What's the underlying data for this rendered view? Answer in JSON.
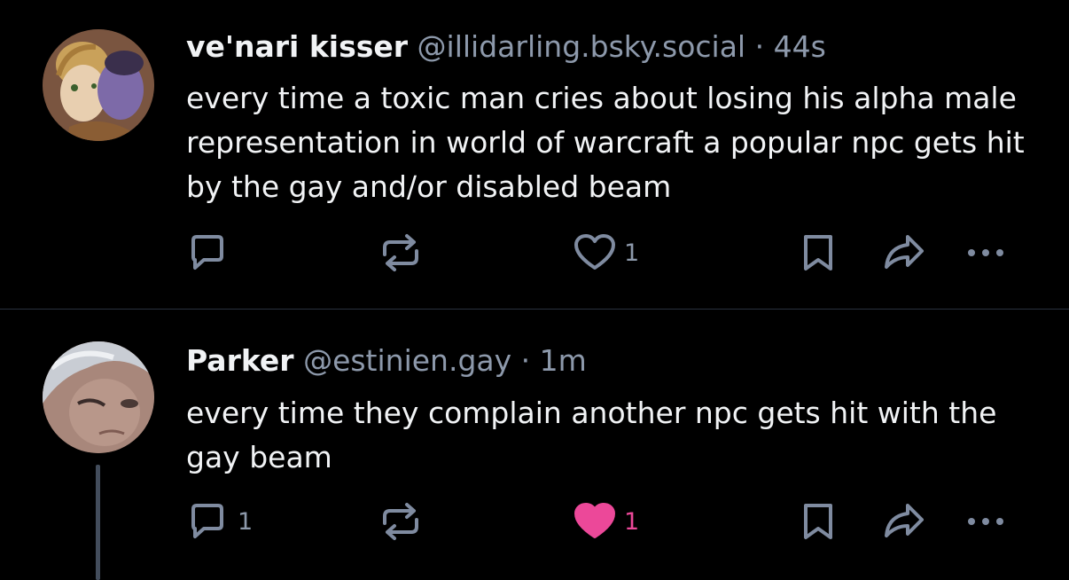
{
  "posts": [
    {
      "author": {
        "display_name": "ve'nari kisser",
        "handle": "@illidarling.bsky.social",
        "avatar_icon": "illustrated-avatar"
      },
      "separator": "·",
      "time": "44s",
      "text": "every time a toxic man cries about losing his alpha male representation in world of warcraft a popular npc gets hit by the gay and/or disabled beam",
      "actions": {
        "reply_count": "",
        "repost_count": "",
        "like_count": "1",
        "liked": false
      }
    },
    {
      "author": {
        "display_name": "Parker",
        "handle": "@estinien.gay",
        "avatar_icon": "photo-avatar"
      },
      "separator": "·",
      "time": "1m",
      "text": "every time they complain another npc gets hit with the gay beam",
      "actions": {
        "reply_count": "1",
        "repost_count": "",
        "like_count": "1",
        "liked": true
      }
    }
  ],
  "colors": {
    "background": "#000000",
    "text_primary": "#f1f3f5",
    "text_secondary": "#8d99ab",
    "icon": "#7f8ba0",
    "like_active": "#ec4899",
    "divider": "#2a323e"
  }
}
